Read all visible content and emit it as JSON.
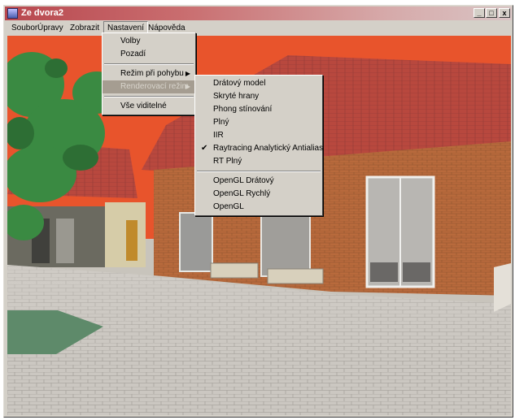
{
  "window": {
    "title": "Ze dvora2",
    "controls": {
      "minimize": "_",
      "maximize": "□",
      "close": "x"
    }
  },
  "menubar": {
    "items": [
      "Soubor",
      "Úpravy",
      "Zobrazit",
      "Nastavení",
      "Nápověda"
    ],
    "open_item": "Nastavení"
  },
  "nastaveni_menu": {
    "items": [
      {
        "label": "Volby"
      },
      {
        "label": "Pozadí"
      },
      {
        "label": "Režim při pohybu",
        "submenu": true
      },
      {
        "label": "Renderovací režim",
        "submenu": true,
        "highlighted": true
      },
      {
        "label": "Vše viditelné"
      }
    ]
  },
  "render_submenu": {
    "items": [
      {
        "label": "Drátový model"
      },
      {
        "label": "Skryté hrany"
      },
      {
        "label": "Phong stínování"
      },
      {
        "label": "Plný"
      },
      {
        "label": "IIR"
      },
      {
        "label": "Raytracing Analytický Antialias",
        "checked": true
      },
      {
        "label": "RT Plný"
      },
      {
        "label": "OpenGL Drátový"
      },
      {
        "label": "OpenGL Rychlý"
      },
      {
        "label": "OpenGL"
      }
    ]
  },
  "colors": {
    "titlebar_start": "#b8474e",
    "sky": "#e8542c",
    "roof": "#b8483e",
    "brick": "#b86a3c",
    "pavement": "#c9c5bf"
  }
}
